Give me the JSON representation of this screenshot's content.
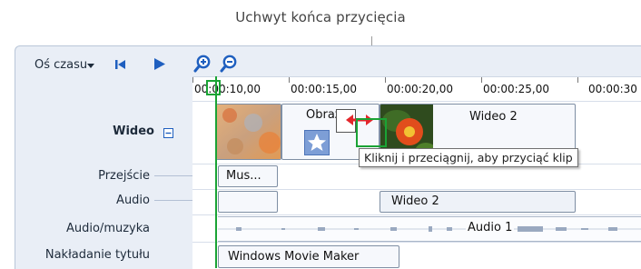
{
  "callout": {
    "text": "Uchwyt końca przycięcia"
  },
  "toolbar": {
    "label": "Oś czasu",
    "caret_icon": "chevron-down-icon",
    "skip_back_icon": "skip-to-start-icon",
    "play_icon": "play-icon",
    "zoom_in_icon": "zoom-in-icon",
    "zoom_out_icon": "zoom-out-icon"
  },
  "ruler": {
    "ticks": [
      "00:00:10,00",
      "00:00:15,00",
      "00:00:20,00",
      "00:00:25,00",
      "00:00:30"
    ]
  },
  "tracks": {
    "video": {
      "label": "Wideo",
      "collapse_icon": "minus-box-icon"
    },
    "transition": {
      "label": "Przejście"
    },
    "audio": {
      "label": "Audio"
    },
    "audio_music": {
      "label": "Audio/muzyka"
    },
    "title_overlay": {
      "label": "Nakładanie tytułu"
    }
  },
  "clips": {
    "image_clip": {
      "label": "Obraz",
      "badge_icon": "star-icon"
    },
    "video2_clip": {
      "label": "Wideo 2"
    },
    "transition_clip": {
      "label": "Mus..."
    },
    "audio_clip": {
      "label": "Wideo 2"
    },
    "audio1_clip": {
      "label": "Audio 1"
    },
    "title_clip": {
      "label": "Windows Movie Maker"
    }
  },
  "tooltip": {
    "text": "Kliknij i przeciągnij, aby przyciąć klip"
  },
  "colors": {
    "accent_green": "#1aa335",
    "trim_arrow_red": "#e3262b",
    "toolbar_blue": "#1f5fbf"
  }
}
